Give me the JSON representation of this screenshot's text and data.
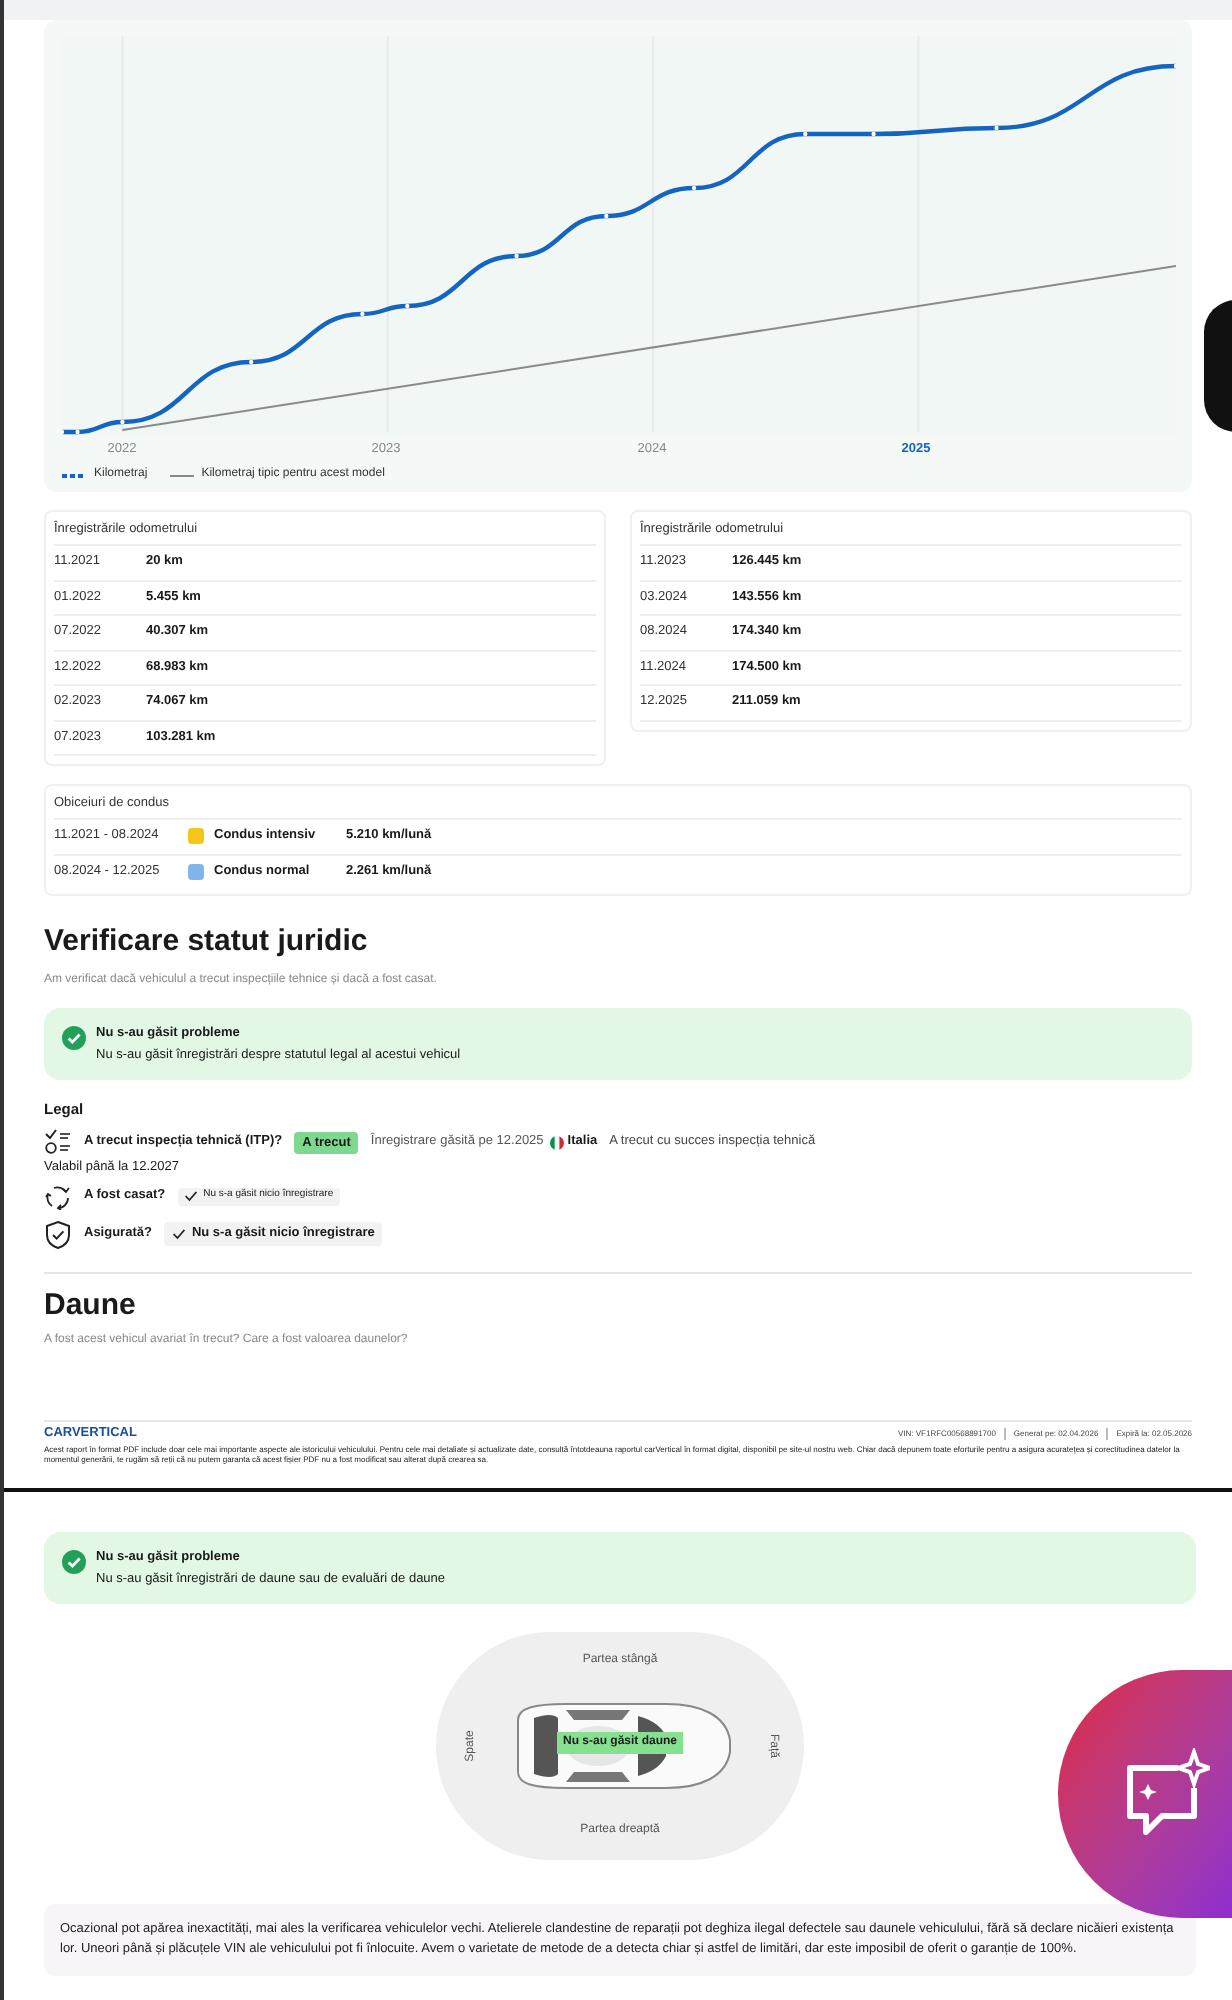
{
  "chart": {
    "ticks": [
      {
        "label": "2022",
        "selected": false
      },
      {
        "label": "2023",
        "selected": false
      },
      {
        "label": "2024",
        "selected": false
      },
      {
        "label": "2025",
        "selected": true
      }
    ],
    "legend": [
      {
        "label": "Kilometraj",
        "kind": "dashed"
      },
      {
        "label": "Kilometraj tipic pentru acest model",
        "kind": "solid"
      }
    ]
  },
  "odometer_tables": [
    {
      "title": "Înregistrările odometrului",
      "rows": [
        {
          "date": "11.2021",
          "value": "20 km"
        },
        {
          "date": "01.2022",
          "value": "5.455 km"
        },
        {
          "date": "07.2022",
          "value": "40.307 km"
        },
        {
          "date": "12.2022",
          "value": "68.983 km"
        },
        {
          "date": "02.2023",
          "value": "74.067 km"
        },
        {
          "date": "07.2023",
          "value": "103.281 km"
        }
      ]
    },
    {
      "title": "Înregistrările odometrului",
      "rows": [
        {
          "date": "11.2023",
          "value": "126.445 km"
        },
        {
          "date": "03.2024",
          "value": "143.556 km"
        },
        {
          "date": "08.2024",
          "value": "174.340 km"
        },
        {
          "date": "11.2024",
          "value": "174.500 km"
        },
        {
          "date": "12.2025",
          "value": "211.059 km"
        }
      ]
    }
  ],
  "driving_habits": {
    "title": "Obiceiuri de condus",
    "rows": [
      {
        "period": "11.2021 - 08.2024",
        "color": "#f5c518",
        "label": "Condus intensiv",
        "rate": "5.210 km/lună"
      },
      {
        "period": "08.2024 - 12.2025",
        "color": "#7fb5ea",
        "label": "Condus normal",
        "rate": "2.261 km/lună"
      }
    ]
  },
  "legal_section": {
    "title": "Verificare statut juridic",
    "subtitle": "Am verificat dacă vehiculul a trecut inspecțiile tehnice și dacă a fost casat.",
    "alert": {
      "title": "Nu s-au găsit probleme",
      "text": "Nu s-au găsit înregistrări despre statutul legal al acestui vehicul"
    },
    "legal_title": "Legal",
    "checks": [
      {
        "kind": "inspection",
        "question": "A trecut inspecția tehnică (ITP)?",
        "badge": "A trecut",
        "found": "Înregistrare găsită pe 12.2025",
        "country": "Italia",
        "result": "A trecut cu succes inspecția tehnică",
        "validity": "Valabil până la 12.2027"
      },
      {
        "kind": "scrapped",
        "question": "A fost casat?",
        "badge": "Nu s-a găsit nicio înregistrare"
      },
      {
        "kind": "insured",
        "question": "Asigurată?",
        "badge": "Nu s-a găsit nicio înregistrare"
      }
    ]
  },
  "damage_section": {
    "title": "Daune",
    "subtitle": "A fost acest vehicul avariat în trecut? Care a fost valoarea daunelor?"
  },
  "footer": {
    "logo": "CARVERTICAL",
    "vin": "VIN: VF1RFC00568891700",
    "generated": "Generat pe: 02.04.2026",
    "expires": "Expiră la: 02.05.2026",
    "note": "Acest raport în format PDF include doar cele mai importante aspecte ale istoricului vehiculului. Pentru cele mai detaliate și actualizate date, consultă întotdeauna raportul carVertical în format digital, disponibil pe site-ul nostru web. Chiar dacă depunem toate eforturile pentru a asigura acuratețea și corectitudinea datelor la momentul generării, te rugăm să reții că nu putem garanta că acest fișier PDF nu a fost modificat sau alterat după crearea sa."
  },
  "damage_result": {
    "alert": {
      "title": "Nu s-au găsit probleme",
      "text": "Nu s-au găsit înregistrări de daune sau de evaluări de daune"
    },
    "diagram": {
      "top": "Partea stângă",
      "bottom": "Partea dreaptă",
      "left": "Spate",
      "right": "Față",
      "badge": "Nu s-au găsit daune"
    },
    "disclaimer": "Ocazional pot apărea inexactități, mai ales la verificarea vehiculelor vechi. Atelierele clandestine de reparații pot deghiza ilegal defectele sau daunele vehiculului, fără să declare nicăieri existența lor. Uneori până și plăcuțele VIN ale vehiculului pot fi înlocuite. Avem o varietate de metode de a detecta chiar și astfel de limitări, dar este imposibil de oferit o garanție de 100%."
  }
}
